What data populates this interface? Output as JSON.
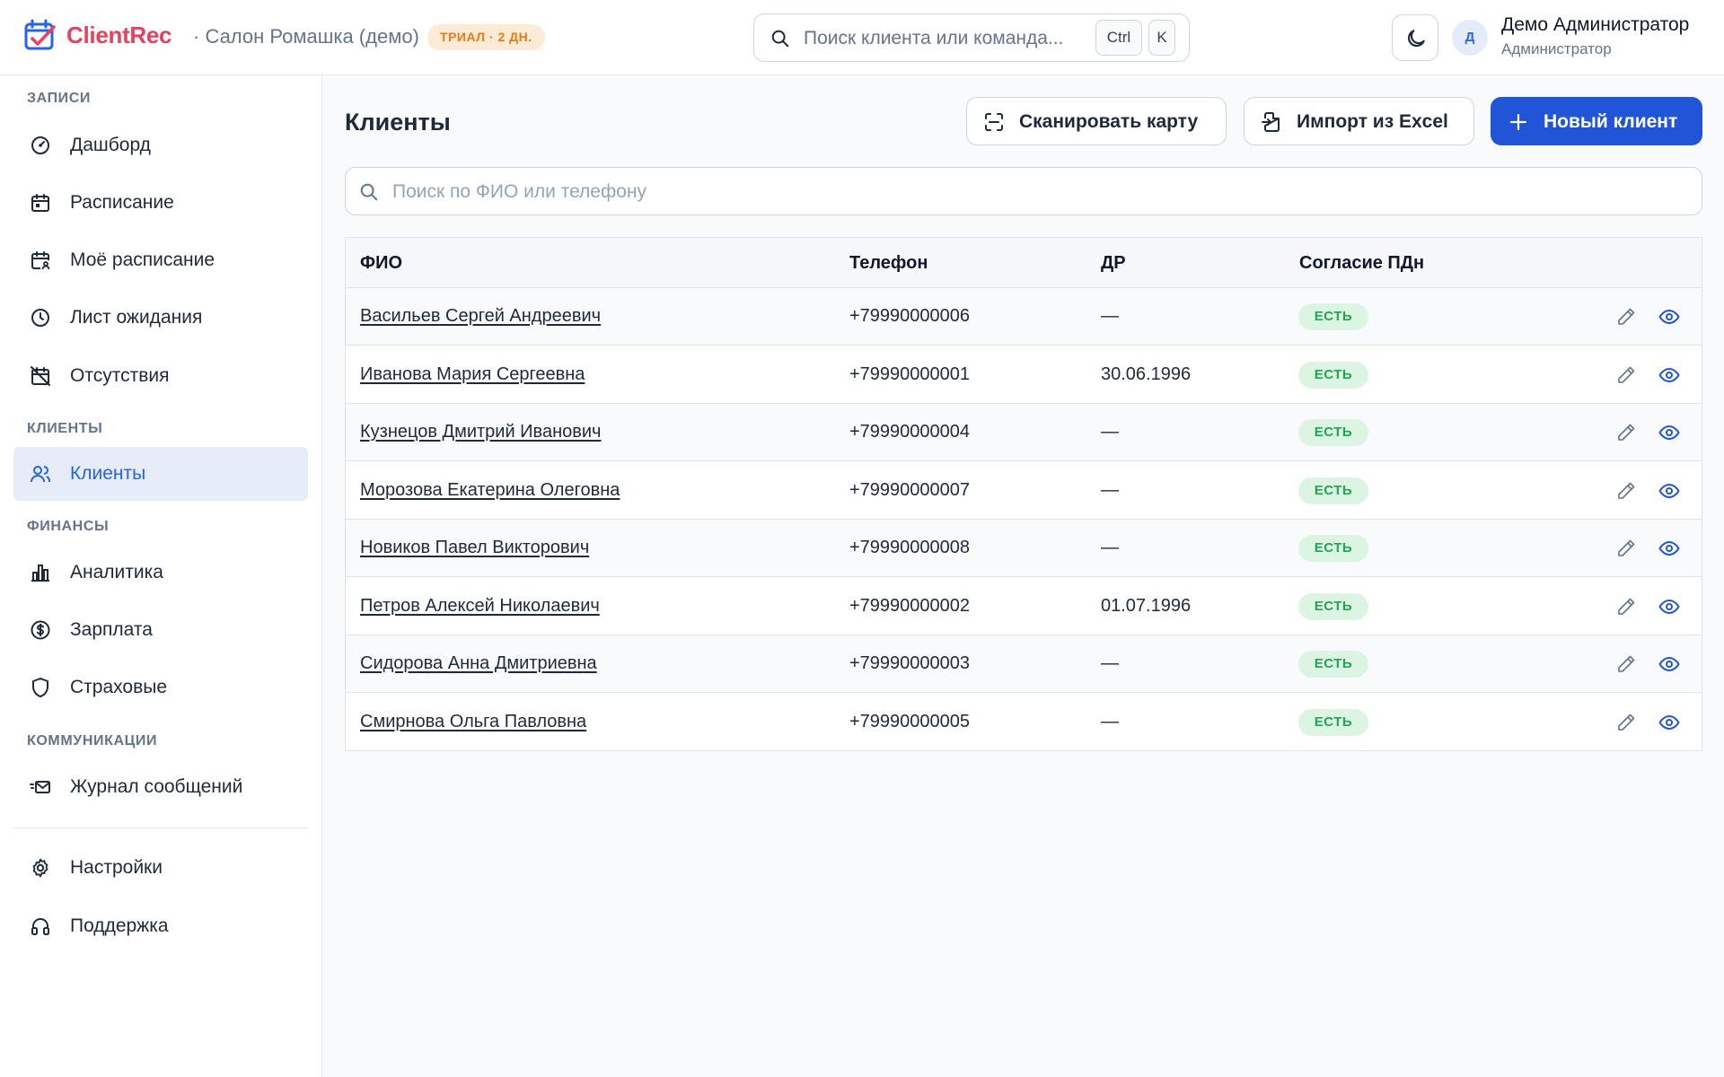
{
  "header": {
    "app_name": "ClientRec",
    "salon": "· Салон Ромашка (демо)",
    "trial_badge": "ТРИАЛ · 2 ДН.",
    "search_placeholder": "Поиск клиента или команда...",
    "shortcut_keys": [
      "Ctrl",
      "K"
    ],
    "user": {
      "initial": "Д",
      "name": "Демо Администратор",
      "role": "Администратор"
    }
  },
  "sidebar": {
    "sections": {
      "records": "ЗАПИСИ",
      "clients": "КЛИЕНТЫ",
      "finance": "ФИНАНСЫ",
      "comms": "КОММУНИКАЦИИ"
    },
    "items": {
      "dashboard": "Дашборд",
      "schedule": "Расписание",
      "my_schedule": "Моё расписание",
      "waitlist": "Лист ожидания",
      "absences": "Отсутствия",
      "clients": "Клиенты",
      "analytics": "Аналитика",
      "salary": "Зарплата",
      "insurance": "Страховые",
      "message_log": "Журнал сообщений",
      "settings": "Настройки",
      "support": "Поддержка"
    },
    "active_item": "clients"
  },
  "main": {
    "title": "Клиенты",
    "buttons": {
      "scan": "Сканировать карту",
      "import": "Импорт из Excel",
      "new_client": "Новый клиент"
    },
    "search_placeholder": "Поиск по ФИО или телефону",
    "table": {
      "columns": [
        "ФИО",
        "Телефон",
        "ДР",
        "Согласие ПДн"
      ],
      "rows": [
        {
          "name": "Васильев Сергей Андреевич",
          "phone": "+79990000006",
          "dob": "—",
          "consent": "ЕСТЬ"
        },
        {
          "name": "Иванова Мария Сергеевна",
          "phone": "+79990000001",
          "dob": "30.06.1996",
          "consent": "ЕСТЬ"
        },
        {
          "name": "Кузнецов Дмитрий Иванович",
          "phone": "+79990000004",
          "dob": "—",
          "consent": "ЕСТЬ"
        },
        {
          "name": "Морозова Екатерина Олеговна",
          "phone": "+79990000007",
          "dob": "—",
          "consent": "ЕСТЬ"
        },
        {
          "name": "Новиков Павел Викторович",
          "phone": "+79990000008",
          "dob": "—",
          "consent": "ЕСТЬ"
        },
        {
          "name": "Петров Алексей Николаевич",
          "phone": "+79990000002",
          "dob": "01.07.1996",
          "consent": "ЕСТЬ"
        },
        {
          "name": "Сидорова Анна Дмитриевна",
          "phone": "+79990000003",
          "dob": "—",
          "consent": "ЕСТЬ"
        },
        {
          "name": "Смирнова Ольга Павловна",
          "phone": "+79990000005",
          "dob": "—",
          "consent": "ЕСТЬ"
        }
      ]
    }
  },
  "colors": {
    "brand": "#e8415e",
    "primary": "#2154d6",
    "trial_bg": "#fdebd6",
    "trial_text": "#ea7a17",
    "consent_bg": "#dcf5e3",
    "consent_text": "#22a454"
  },
  "icons": {
    "logo": "calendar-check-icon",
    "search": "search-icon",
    "theme": "moon-icon",
    "edit": "pencil-icon",
    "view": "eye-icon"
  }
}
